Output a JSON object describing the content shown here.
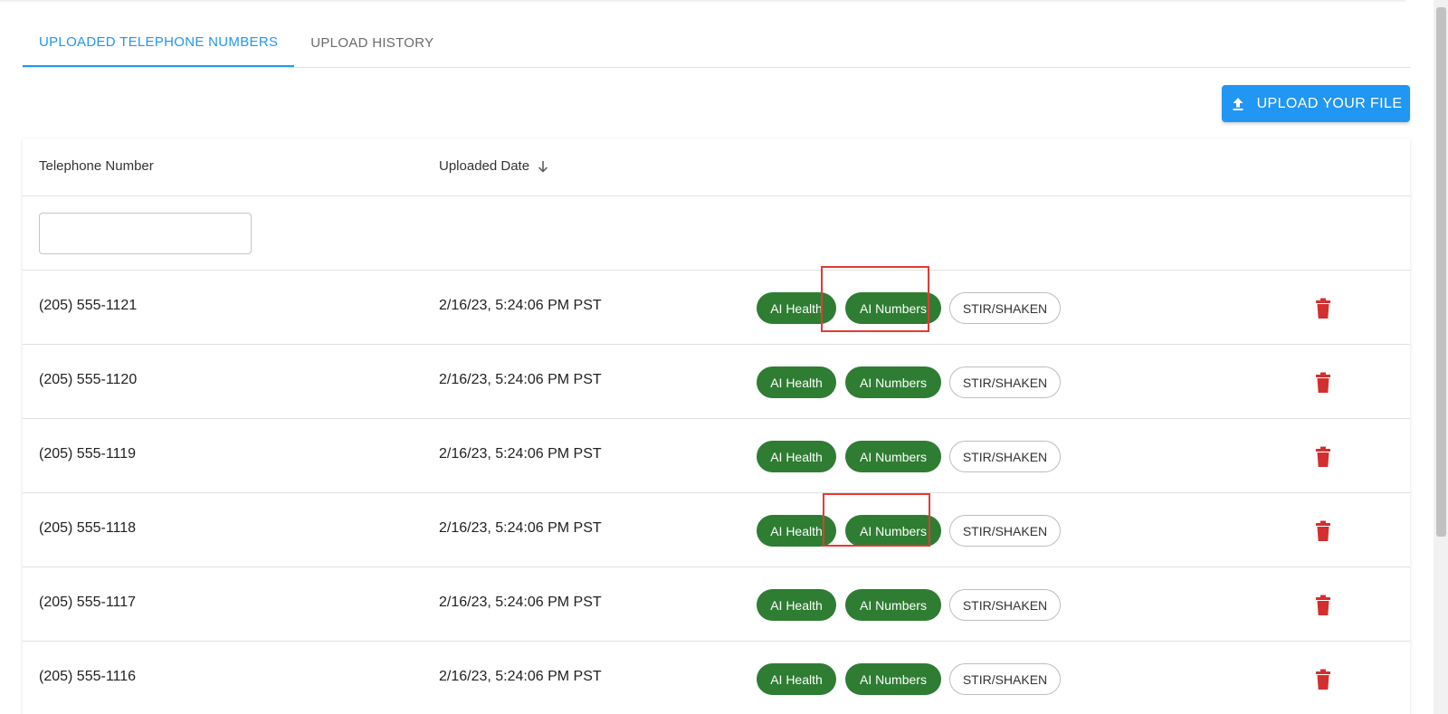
{
  "tabs": [
    {
      "label": "UPLOADED TELEPHONE NUMBERS",
      "active": true
    },
    {
      "label": "UPLOAD HISTORY",
      "active": false
    }
  ],
  "upload_button": {
    "label": "UPLOAD YOUR FILE",
    "icon": "upload-icon"
  },
  "table": {
    "columns": {
      "telephone": "Telephone Number",
      "uploaded_date": "Uploaded Date",
      "sort_icon": "arrow-down-icon"
    },
    "filter": {
      "value": "",
      "placeholder": ""
    },
    "chips": {
      "health": "AI Health",
      "numbers": "AI Numbers",
      "stir": "STIR/SHAKEN"
    },
    "rows": [
      {
        "number": "(205) 555-1121",
        "date": "2/16/23, 5:24:06 PM PST"
      },
      {
        "number": "(205) 555-1120",
        "date": "2/16/23, 5:24:06 PM PST"
      },
      {
        "number": "(205) 555-1119",
        "date": "2/16/23, 5:24:06 PM PST"
      },
      {
        "number": "(205) 555-1118",
        "date": "2/16/23, 5:24:06 PM PST"
      },
      {
        "number": "(205) 555-1117",
        "date": "2/16/23, 5:24:06 PM PST"
      },
      {
        "number": "(205) 555-1116",
        "date": "2/16/23, 5:24:06 PM PST"
      }
    ]
  },
  "colors": {
    "accent": "#2196f3",
    "chip_green": "#2e7d32",
    "delete": "#d32f2f",
    "highlight": "#e53935"
  }
}
